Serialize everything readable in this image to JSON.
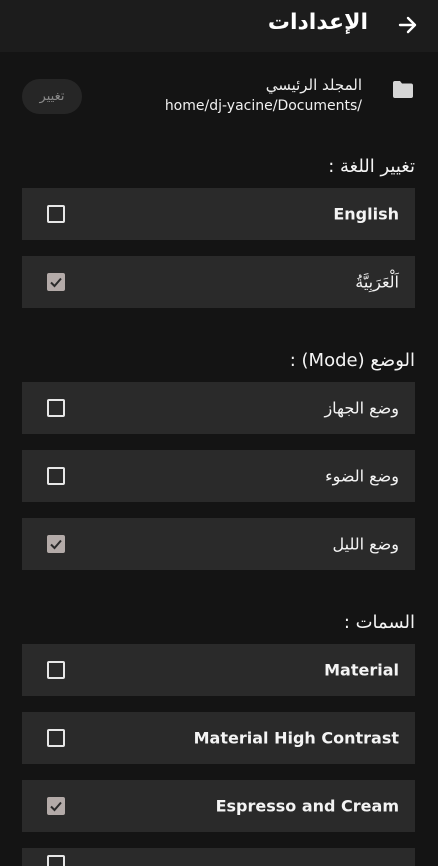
{
  "header": {
    "title": "الإعدادات",
    "back_icon": "arrow-right-icon"
  },
  "folder": {
    "icon": "folder-icon",
    "label": "المجلد الرئيسي",
    "path": "home/dj-yacine/Documents/",
    "change_label": "تغيير"
  },
  "language": {
    "title": "تغيير اللغة :",
    "options": [
      {
        "label": "English",
        "checked": false
      },
      {
        "label": "اَلْعَرَبِيَّةُ",
        "checked": true
      }
    ]
  },
  "mode": {
    "title": "الوضع (Mode)  :",
    "options": [
      {
        "label": "وضع الجهاز",
        "checked": false
      },
      {
        "label": "وضع الضوء",
        "checked": false
      },
      {
        "label": "وضع الليل",
        "checked": true
      }
    ]
  },
  "themes": {
    "title": "السمات :",
    "options": [
      {
        "label": "Material",
        "checked": false
      },
      {
        "label": "Material High Contrast",
        "checked": false
      },
      {
        "label": "Espresso and Cream",
        "checked": true
      }
    ]
  },
  "colors": {
    "background": "#141414",
    "header": "#1c1c1c",
    "card": "#2a2a2a",
    "checked": "#b3aaa8"
  }
}
